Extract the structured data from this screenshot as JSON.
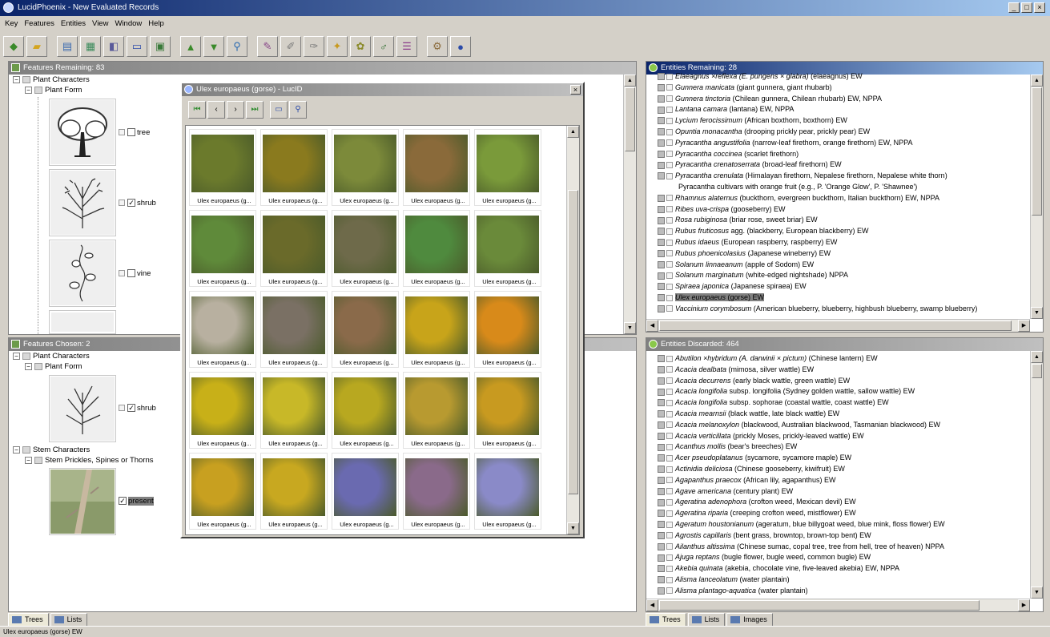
{
  "window": {
    "title": "LucidPhoenix - New Evaluated Records"
  },
  "menu": [
    "Key",
    "Features",
    "Entities",
    "View",
    "Window",
    "Help"
  ],
  "toolbar_icons": [
    "open-key-icon",
    "open-folder-icon",
    "features-icon",
    "entities-icon",
    "restore-icon",
    "list-view-icon",
    "grid-view-icon",
    "discard-icon",
    "evaluate-icon",
    "search-icon",
    "best-icon",
    "pencil-icon",
    "edit-icon",
    "star-icon",
    "bug-icon",
    "link-icon",
    "list-icon",
    "settings-icon",
    "help-icon"
  ],
  "features_remaining": {
    "title": "Features Remaining: 83",
    "tree": [
      {
        "label": "Plant Characters"
      },
      {
        "label": "Plant Form"
      }
    ],
    "states": [
      {
        "label": "tree",
        "checked": false
      },
      {
        "label": "shrub",
        "checked": true
      },
      {
        "label": "vine",
        "checked": false
      }
    ]
  },
  "features_chosen": {
    "title": "Features Chosen: 2",
    "tree": [
      {
        "label": "Plant Characters"
      },
      {
        "label": "Plant Form"
      },
      {
        "label": "shrub"
      },
      {
        "label": "Stem Characters"
      },
      {
        "label": "Stem Prickles, Spines or Thorns"
      },
      {
        "label": "present"
      }
    ]
  },
  "left_tabs": [
    "Trees",
    "Lists"
  ],
  "right_tabs": [
    "Trees",
    "Lists",
    "Images"
  ],
  "entities_remaining": {
    "title": "Entities Remaining: 28",
    "rows": [
      {
        "latin": "Elaeagnus ×reflexa (E. pungens × glabra)",
        "rest": " (elaeagnus) EW"
      },
      {
        "latin": "Gunnera manicata",
        "rest": " (giant gunnera, giant rhubarb)"
      },
      {
        "latin": "Gunnera tinctoria",
        "rest": " (Chilean gunnera, Chilean rhubarb) EW, NPPA"
      },
      {
        "latin": "Lantana camara",
        "rest": " (lantana) EW, NPPA"
      },
      {
        "latin": "Lycium ferocissimum",
        "rest": " (African boxthorn, boxthorn) EW"
      },
      {
        "latin": "Opuntia monacantha",
        "rest": " (drooping prickly pear, prickly pear) EW"
      },
      {
        "latin": "Pyracantha angustifolia",
        "rest": " (narrow-leaf firethorn, orange firethorn) EW, NPPA"
      },
      {
        "latin": "Pyracantha coccinea",
        "rest": " (scarlet firethorn)"
      },
      {
        "latin": "Pyracantha crenatoserrata",
        "rest": " (broad-leaf firethorn) EW"
      },
      {
        "latin": "Pyracantha crenulata",
        "rest": " (Himalayan firethorn, Nepalese firethorn, Nepalese white thorn)"
      },
      {
        "latin": "",
        "rest": "Pyracantha cultivars with orange fruit (e.g., P. 'Orange Glow', P. 'Shawnee')",
        "indent": true
      },
      {
        "latin": "Rhamnus alaternus",
        "rest": " (buckthorn, evergreen buckthorn, Italian buckthorn) EW, NPPA"
      },
      {
        "latin": "Ribes uva-crispa",
        "rest": " (gooseberry) EW"
      },
      {
        "latin": "Rosa rubiginosa",
        "rest": " (briar rose, sweet briar) EW"
      },
      {
        "latin": "Rubus fruticosus",
        "rest": " agg. (blackberry, European blackberry) EW"
      },
      {
        "latin": "Rubus idaeus",
        "rest": " (European raspberry, raspberry) EW"
      },
      {
        "latin": "Rubus phoenicolasius",
        "rest": " (Japanese wineberry) EW"
      },
      {
        "latin": "Solanum linnaeanum",
        "rest": " (apple of Sodom) EW"
      },
      {
        "latin": "Solanum marginatum",
        "rest": " (white-edged nightshade) NPPA"
      },
      {
        "latin": "Spiraea japonica",
        "rest": " (Japanese spiraea) EW"
      },
      {
        "latin": "Ulex europaeus",
        "rest": " (gorse) EW",
        "selected": true
      },
      {
        "latin": "Vaccinium corymbosum",
        "rest": " (American blueberry, blueberry, highbush blueberry, swamp blueberry)"
      }
    ]
  },
  "entities_discarded": {
    "title": "Entities Discarded: 464",
    "rows": [
      {
        "latin": "Abutilon ×hybridum (A. darwinii × pictum)",
        "rest": " (Chinese lantern) EW"
      },
      {
        "latin": "Acacia dealbata",
        "rest": " (mimosa, silver wattle) EW"
      },
      {
        "latin": "Acacia decurrens",
        "rest": " (early black wattle, green wattle) EW"
      },
      {
        "latin": "Acacia longifolia",
        "rest": " subsp. longifolia (Sydney golden wattle, sallow wattle) EW"
      },
      {
        "latin": "Acacia longifolia",
        "rest": " subsp. sophorae (coastal wattle, coast wattle) EW"
      },
      {
        "latin": "Acacia mearnsii",
        "rest": " (black wattle, late black wattle) EW"
      },
      {
        "latin": "Acacia melanoxylon",
        "rest": " (blackwood, Australian blackwood, Tasmanian blackwood) EW"
      },
      {
        "latin": "Acacia verticillata",
        "rest": " (prickly Moses, prickly-leaved wattle) EW"
      },
      {
        "latin": "Acanthus mollis",
        "rest": " (bear's breeches) EW"
      },
      {
        "latin": "Acer pseudoplatanus",
        "rest": " (sycamore, sycamore maple) EW"
      },
      {
        "latin": "Actinidia deliciosa",
        "rest": " (Chinese gooseberry, kiwifruit) EW"
      },
      {
        "latin": "Agapanthus praecox",
        "rest": " (African lily, agapanthus) EW"
      },
      {
        "latin": "Agave americana",
        "rest": " (century plant) EW"
      },
      {
        "latin": "Ageratina adenophora",
        "rest": " (crofton weed, Mexican devil) EW"
      },
      {
        "latin": "Ageratina riparia",
        "rest": " (creeping crofton weed, mistflower) EW"
      },
      {
        "latin": "Ageratum houstonianum",
        "rest": " (ageratum, blue billygoat weed, blue mink, floss flower) EW"
      },
      {
        "latin": "Agrostis capillaris",
        "rest": " (bent grass, browntop, brown-top bent) EW"
      },
      {
        "latin": "Ailanthus altissima",
        "rest": " (Chinese sumac, copal tree, tree from hell, tree of heaven) NPPA"
      },
      {
        "latin": "Ajuga reptans",
        "rest": " (bugle flower, bugle weed, common bugle) EW"
      },
      {
        "latin": "Akebia quinata",
        "rest": " (akebia, chocolate vine, five-leaved akebia) EW, NPPA"
      },
      {
        "latin": "Alisma lanceolatum",
        "rest": " (water plantain)"
      },
      {
        "latin": "Alisma plantago-aquatica",
        "rest": " (water plantain)"
      }
    ]
  },
  "image_viewer": {
    "title": "Ulex europaeus (gorse) - LucID",
    "caption": "Ulex europaeus (g...",
    "photo_colors": [
      [
        "#6b7a2c",
        "#8a7a1e",
        "#7c8a3a",
        "#8a6a3a",
        "#7a9a3a"
      ],
      [
        "#5f8a3a",
        "#6a6a2a",
        "#6e6a4a",
        "#4f8a3e",
        "#6a8a3a"
      ],
      [
        "#b8b0a0",
        "#7a7064",
        "#8a6a4a",
        "#c8a41a",
        "#d88a1a"
      ],
      [
        "#c8b018",
        "#c8b828",
        "#b8a820",
        "#b89a30",
        "#c89a20"
      ],
      [
        "#c8a020",
        "#c8a820",
        "#6a6ab0",
        "#8a6a8a",
        "#8a8ac8"
      ]
    ]
  },
  "statusbar": {
    "text": "Ulex europaeus (gorse) EW"
  }
}
